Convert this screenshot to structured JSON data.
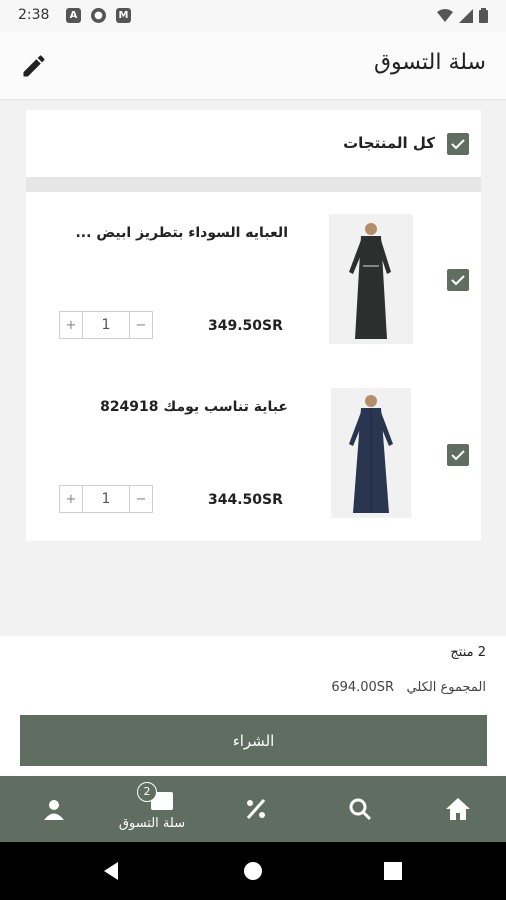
{
  "status_bar": {
    "time": "2:38"
  },
  "header": {
    "title": "سلة التسوق"
  },
  "select_all": {
    "label": "كل المنتجات",
    "checked": true
  },
  "items": [
    {
      "name": "العبايه السوداء بتطريز ابيض ...",
      "price": "349.50SR",
      "quantity": "1",
      "minus": "−",
      "plus": "+",
      "checked": true,
      "image_color": "#2b2f2d"
    },
    {
      "name": "عباية تناسب يومك 824918",
      "price": "344.50SR",
      "quantity": "1",
      "minus": "−",
      "plus": "+",
      "checked": true,
      "image_color": "#2a3550"
    }
  ],
  "summary": {
    "count_text": "2 منتج",
    "total_label": "المجموع الكلي",
    "total_value": "694.00SR",
    "buy_label": "الشراء"
  },
  "bottom_nav": {
    "cart_label": "سلة التسوق",
    "cart_badge": "2"
  },
  "colors": {
    "primary": "#5f6e60",
    "background": "#f2f2f2"
  }
}
